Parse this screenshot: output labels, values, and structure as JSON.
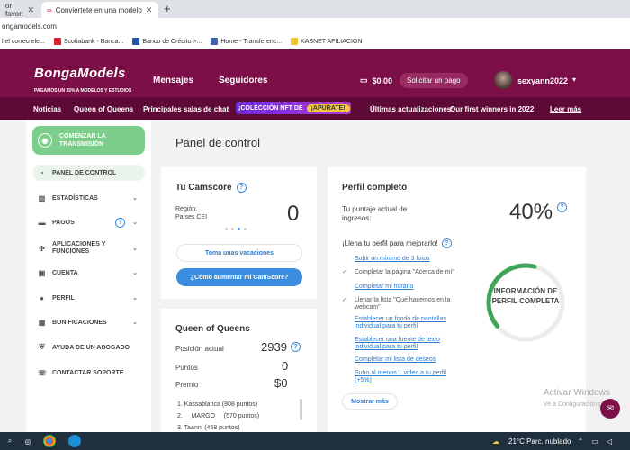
{
  "browser": {
    "tabs": [
      {
        "label": "or favor:"
      },
      {
        "label": "Conviértete en una modelo de B"
      }
    ],
    "url": "ongamodels.com",
    "bookmarks": [
      {
        "label": "l el correo ele...",
        "color": "#8b8b8b"
      },
      {
        "label": "Scotiabank - Banca...",
        "color": "#e0202a"
      },
      {
        "label": "Banco de Crédito >...",
        "color": "#1c57a5"
      },
      {
        "label": "Home - Transferenc...",
        "color": "#3c64a8"
      },
      {
        "label": "KASNET AFILIACION",
        "color": "#f2c230"
      }
    ]
  },
  "header": {
    "logo": "BongaModels",
    "tagline": "PAGAMOS UN 35% A MODELOS Y ESTUDIOS",
    "nav": [
      "Mensajes",
      "Seguidores"
    ],
    "balance": "$0.00",
    "pay_label": "Solicitar un pago",
    "username": "sexyann2022"
  },
  "subnav": {
    "items": [
      "Noticias",
      "Queen of Queens",
      "Principales salas de chat"
    ],
    "nft_label": "¡COLECCIÓN NFT DE",
    "nft_cta": "¡APÚRATE!",
    "updates_label": "Últimas actualizaciones:",
    "updates_text": "Our first winners in 2022",
    "read_more": "Leer más"
  },
  "sidebar": {
    "start_label": "COMENZAR LA TRANSMISIÓN",
    "items": [
      {
        "label": "PANEL DE CONTROL",
        "icon": "gauge-icon"
      },
      {
        "label": "ESTADÍSTICAS",
        "icon": "bar-chart-icon"
      },
      {
        "label": "PAGOS",
        "icon": "wallet-icon"
      },
      {
        "label": "APLICACIONES Y FUNCIONES",
        "icon": "puzzle-icon"
      },
      {
        "label": "CUENTA",
        "icon": "briefcase-icon"
      },
      {
        "label": "PERFIL",
        "icon": "user-icon"
      },
      {
        "label": "BONIFICACIONES",
        "icon": "gift-icon"
      },
      {
        "label": "AYUDA DE UN ABOGADO",
        "icon": "shield-icon"
      },
      {
        "label": "CONTACTAR SOPORTE",
        "icon": "support-icon"
      }
    ]
  },
  "main": {
    "title": "Panel de control",
    "camscore": {
      "title": "Tu Camscore",
      "region_label": "Región:",
      "region_value": "Países CEI",
      "score": "0",
      "vacation_label": "Toma unas vacaciones",
      "improve_label": "¿Cómo aumentar mi CamScore?"
    },
    "queen": {
      "title": "Queen of Queens",
      "position_label": "Posición actual",
      "position_value": "2939",
      "points_label": "Puntos",
      "points_value": "0",
      "prize_label": "Premio",
      "prize_value": "$0",
      "ranking": [
        "1.  Kassablanca (808 puntos)",
        "2.  __MARGO__ (570 puntos)",
        "3.  Taanni (458 puntos)"
      ]
    },
    "profile": {
      "title": "Perfil completo",
      "score_label": "Tu puntaje actual de ingresos:",
      "percent": "40%",
      "progress": 0.4,
      "fill_prompt": "¡Llena tu perfil para mejorarlo!",
      "tasks": [
        {
          "label": "Subir un mínimo de 3 fotos",
          "done": false
        },
        {
          "label": "Completar la página \"Acerca de mí\"",
          "done": true
        },
        {
          "label": "Completar mi horario",
          "done": false
        },
        {
          "label": "Llenar la lista \"Qué hacemos en la webcam\"",
          "done": true
        },
        {
          "label": "Establecer un fondo de pantallas individual para tu perfil",
          "done": false
        },
        {
          "label": "Establecer una fuente de texto individual para tu perfil",
          "done": false
        },
        {
          "label": "Completar mi lista de deseos",
          "done": false
        },
        {
          "label": "Subo al menos 1 video a tu perfil (+5%)",
          "done": false
        }
      ],
      "show_more": "Mostrar más",
      "ring_label": "INFORMACIÓN DE PERFIL COMPLETA"
    }
  },
  "overlay": {
    "watermark_title": "Activar Windows",
    "watermark_sub": "Ve a Configuración para"
  },
  "taskbar": {
    "weather": "21°C  Parc. nublado"
  }
}
